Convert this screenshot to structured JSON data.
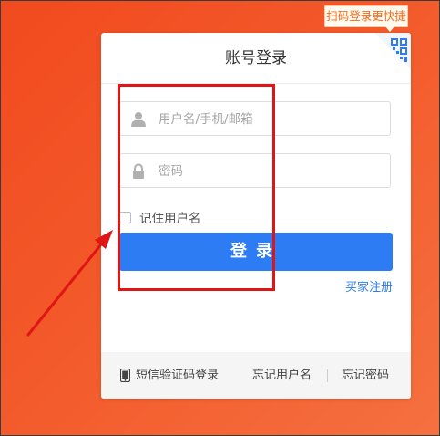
{
  "qr_tip": "扫码登录更快捷",
  "panel": {
    "title": "账号登录",
    "username": {
      "placeholder": "用户名/手机/邮箱",
      "icon": "user-icon"
    },
    "password": {
      "placeholder": "密码",
      "icon": "lock-icon"
    },
    "remember_label": "记住用户名",
    "login_label": "登录",
    "register_label": "买家注册"
  },
  "footer": {
    "sms_label": "短信验证码登录",
    "forgot_username": "忘记用户名",
    "forgot_password": "忘记密码"
  },
  "colors": {
    "background": "#f3592a",
    "accent": "#2d7cf3",
    "annotation": "#e01515"
  }
}
